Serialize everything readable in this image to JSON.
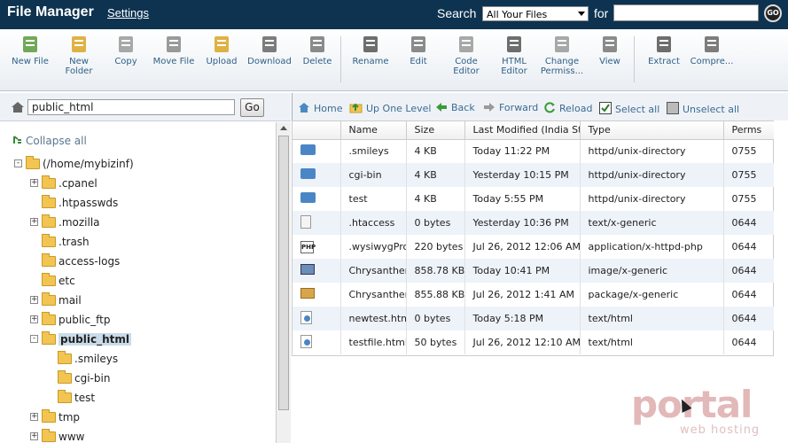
{
  "header": {
    "title": "File Manager",
    "settings_link": "Settings",
    "search_label": "Search",
    "search_scope": "All Your Files",
    "for_label": "for",
    "search_value": "",
    "go_label": "GO"
  },
  "toolbar": {
    "items": [
      {
        "label": "New File",
        "icon": "new-file-icon"
      },
      {
        "label": "New Folder",
        "icon": "new-folder-icon"
      },
      {
        "label": "Copy",
        "icon": "copy-icon"
      },
      {
        "label": "Move File",
        "icon": "move-icon"
      },
      {
        "label": "Upload",
        "icon": "upload-icon"
      },
      {
        "label": "Download",
        "icon": "download-icon"
      },
      {
        "label": "Delete",
        "icon": "delete-icon"
      },
      {
        "label": "Rename",
        "icon": "rename-icon"
      },
      {
        "label": "Edit",
        "icon": "edit-icon"
      },
      {
        "label": "Code Editor",
        "icon": "code-editor-icon"
      },
      {
        "label": "HTML Editor",
        "icon": "html-editor-icon"
      },
      {
        "label": "Change Permiss...",
        "icon": "permissions-icon"
      },
      {
        "label": "View",
        "icon": "view-icon"
      },
      {
        "label": "Extract",
        "icon": "extract-icon"
      },
      {
        "label": "Compre...",
        "icon": "compress-icon"
      }
    ]
  },
  "left": {
    "path_value": "public_html",
    "go_label": "Go",
    "collapse_label": "Collapse all",
    "tree": [
      {
        "label": "(/home/mybizinf)",
        "level": 0,
        "exp": "-"
      },
      {
        "label": ".cpanel",
        "level": 1,
        "exp": "+"
      },
      {
        "label": ".htpasswds",
        "level": 1,
        "exp": ""
      },
      {
        "label": ".mozilla",
        "level": 1,
        "exp": "+"
      },
      {
        "label": ".trash",
        "level": 1,
        "exp": ""
      },
      {
        "label": "access-logs",
        "level": 1,
        "exp": ""
      },
      {
        "label": "etc",
        "level": 1,
        "exp": ""
      },
      {
        "label": "mail",
        "level": 1,
        "exp": "+"
      },
      {
        "label": "public_ftp",
        "level": 1,
        "exp": "+"
      },
      {
        "label": "public_html",
        "level": 1,
        "exp": "-"
      },
      {
        "label": ".smileys",
        "level": 2,
        "exp": ""
      },
      {
        "label": "cgi-bin",
        "level": 2,
        "exp": ""
      },
      {
        "label": "test",
        "level": 2,
        "exp": ""
      },
      {
        "label": "tmp",
        "level": 1,
        "exp": "+"
      },
      {
        "label": "www",
        "level": 1,
        "exp": "+"
      }
    ]
  },
  "nav": {
    "home": "Home",
    "up": "Up One Level",
    "back": "Back",
    "forward": "Forward",
    "reload": "Reload",
    "select_all": "Select all",
    "unselect_all": "Unselect all"
  },
  "grid": {
    "columns": [
      "Name",
      "Size",
      "Last Modified (India Standard Time)",
      "Type",
      "Perms"
    ],
    "rows": [
      {
        "icon": "folder",
        "name": ".smileys",
        "size": "4 KB",
        "modified": "Today 11:22 PM",
        "type": "httpd/unix-directory",
        "perms": "0755"
      },
      {
        "icon": "folder",
        "name": "cgi-bin",
        "size": "4 KB",
        "modified": "Yesterday 10:15 PM",
        "type": "httpd/unix-directory",
        "perms": "0755"
      },
      {
        "icon": "folder",
        "name": "test",
        "size": "4 KB",
        "modified": "Today 5:55 PM",
        "type": "httpd/unix-directory",
        "perms": "0755"
      },
      {
        "icon": "doc",
        "name": ".htaccess",
        "size": "0 bytes",
        "modified": "Yesterday 10:36 PM",
        "type": "text/x-generic",
        "perms": "0644"
      },
      {
        "icon": "php",
        "name": ".wysiwygPro",
        "size": "220 bytes",
        "modified": "Jul 26, 2012 12:06 AM",
        "type": "application/x-httpd-php",
        "perms": "0644"
      },
      {
        "icon": "img",
        "name": "Chrysanthemum",
        "size": "858.78 KB",
        "modified": "Today 10:41 PM",
        "type": "image/x-generic",
        "perms": "0644"
      },
      {
        "icon": "pkg",
        "name": "Chrysanthemum",
        "size": "855.88 KB",
        "modified": "Jul 26, 2012 1:41 AM",
        "type": "package/x-generic",
        "perms": "0644"
      },
      {
        "icon": "html",
        "name": "newtest.html",
        "size": "0 bytes",
        "modified": "Today 5:18 PM",
        "type": "text/html",
        "perms": "0644"
      },
      {
        "icon": "html",
        "name": "testfile.html",
        "size": "50 bytes",
        "modified": "Jul 26, 2012 12:10 AM",
        "type": "text/html",
        "perms": "0644"
      }
    ]
  },
  "watermark": {
    "brand": "portal",
    "sub": "web hosting"
  }
}
